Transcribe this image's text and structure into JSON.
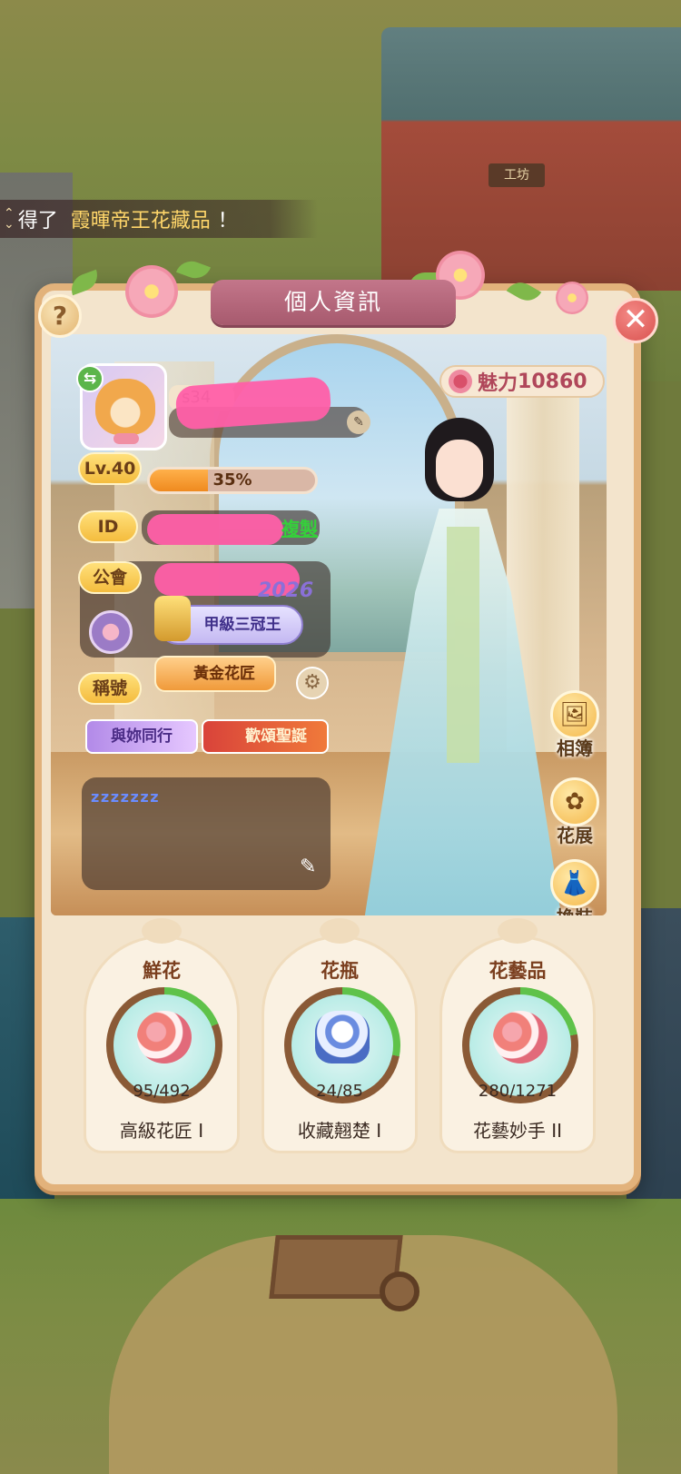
{
  "ticker": {
    "prefix": "得了",
    "highlight": "霞暉帝王花藏品",
    "suffix": "！"
  },
  "building_sign": "工坊",
  "panel": {
    "title": "個人資訊",
    "help_icon": "?",
    "close_icon": "✕"
  },
  "profile": {
    "server": "s34",
    "charm_label": "魅力",
    "charm_value": "10860",
    "level_label": "Lv.40",
    "exp_percent": 35,
    "exp_text": "35%",
    "id_label": "ID",
    "copy_label": "複製",
    "guild_label": "公會",
    "rank_badge": "甲級三冠王",
    "rank_year": "2026",
    "title_label": "稱號",
    "title_main": "黃金花匠",
    "title_a": "與妳同行",
    "title_b": "歡頌聖誕",
    "signature": "z z z z z z z"
  },
  "side_buttons": [
    {
      "label": "相簿",
      "icon": "photo-album-icon",
      "glyph": "🖼"
    },
    {
      "label": "花展",
      "icon": "flower-show-icon",
      "glyph": "✿"
    },
    {
      "label": "換裝",
      "icon": "dress-icon",
      "glyph": "👗"
    }
  ],
  "collections": [
    {
      "name": "鮮花",
      "count": "95/492",
      "progress": 0.19,
      "rank": "高級花匠 I"
    },
    {
      "name": "花瓶",
      "count": "24/85",
      "progress": 0.28,
      "rank": "收藏翹楚 I"
    },
    {
      "name": "花藝品",
      "count": "280/1271",
      "progress": 0.22,
      "rank": "花藝妙手 II"
    }
  ],
  "colors": {
    "ring_track": "#8a5a36",
    "ring_fill": "#5fc24a"
  }
}
